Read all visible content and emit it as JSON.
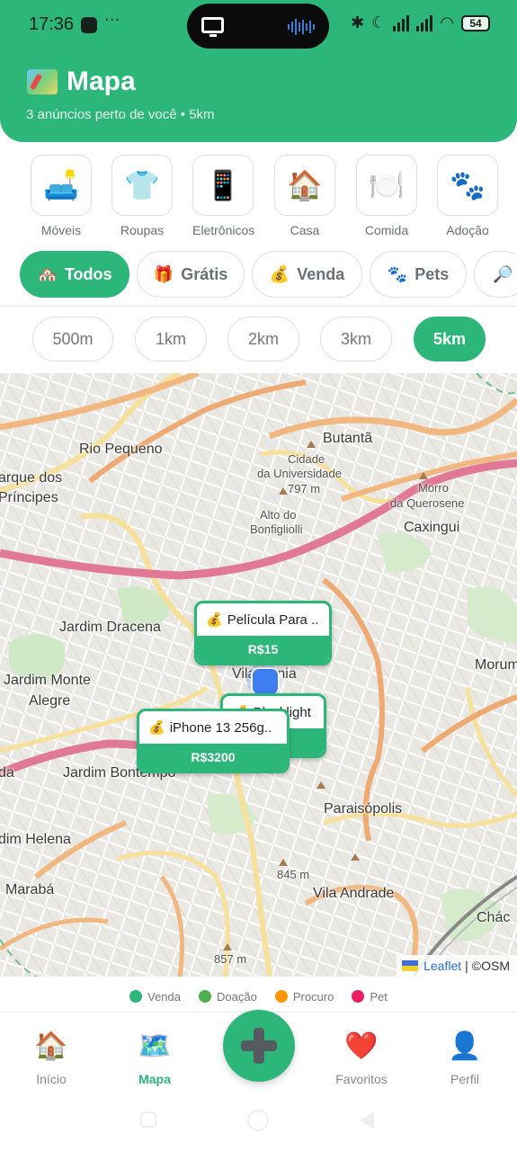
{
  "status_bar": {
    "time": "17:36",
    "dots": "···",
    "battery": "54"
  },
  "header": {
    "title": "Mapa",
    "subtitle": "3 anúncios perto de você • 5km"
  },
  "categories": [
    {
      "label": "Móveis",
      "icon": "🛋️"
    },
    {
      "label": "Roupas",
      "icon": "👕"
    },
    {
      "label": "Eletrônicos",
      "icon": "📱"
    },
    {
      "label": "Casa",
      "icon": "🏠"
    },
    {
      "label": "Comida",
      "icon": "🍽️"
    },
    {
      "label": "Adoção",
      "icon": "🐾"
    }
  ],
  "filters": [
    {
      "label": "Todos",
      "icon": "🏘️",
      "active": true
    },
    {
      "label": "Grátis",
      "icon": "🎁",
      "active": false
    },
    {
      "label": "Venda",
      "icon": "💰",
      "active": false
    },
    {
      "label": "Pets",
      "icon": "🐾",
      "active": false
    },
    {
      "label": "",
      "icon": "🔎",
      "active": false
    }
  ],
  "distances": [
    {
      "label": "500m",
      "active": false
    },
    {
      "label": "1km",
      "active": false
    },
    {
      "label": "2km",
      "active": false
    },
    {
      "label": "3km",
      "active": false
    },
    {
      "label": "5km",
      "active": true
    }
  ],
  "map": {
    "places": [
      "Rio Pequeno",
      "Butantã",
      "arque dos",
      "Príncipes",
      "Cidade",
      "da Universidade",
      "797 m",
      "Alto do",
      "Bonfigliolli",
      "Morro",
      "da Querosene",
      "Caxingui",
      "Jardim Dracena",
      "Jardim Monte",
      "Alegre",
      "Vila Sônia",
      "Morum",
      "da",
      "Jardim Bontempo",
      "Paraisópolis",
      "dim Helena",
      "845 m",
      "Marabá",
      "Vila Andrade",
      "Chác",
      "857 m"
    ],
    "listings": [
      {
        "icon": "💰",
        "title": "Película Para ..",
        "price": "R$15"
      },
      {
        "icon": "💰",
        "title": "Blacklight",
        "price": ""
      },
      {
        "icon": "💰",
        "title": "iPhone 13 256g..",
        "price": "R$3200"
      }
    ],
    "attribution": {
      "leaflet": "Leaflet",
      "separator": "|",
      "osm": "©OSM"
    }
  },
  "legend": [
    {
      "label": "Venda",
      "color": "#2db67a"
    },
    {
      "label": "Doação",
      "color": "#4caf50"
    },
    {
      "label": "Procuro",
      "color": "#ff9800"
    },
    {
      "label": "Pet",
      "color": "#e91e63"
    }
  ],
  "bottom_nav": [
    {
      "label": "Início",
      "icon": "🏠",
      "active": false
    },
    {
      "label": "Mapa",
      "icon": "🗺️",
      "active": true
    },
    {
      "label": "Favoritos",
      "icon": "❤️",
      "active": false
    },
    {
      "label": "Perfil",
      "icon": "👤",
      "active": false
    }
  ],
  "colors": {
    "primary": "#2db67a",
    "user_location": "#3f7df2"
  }
}
